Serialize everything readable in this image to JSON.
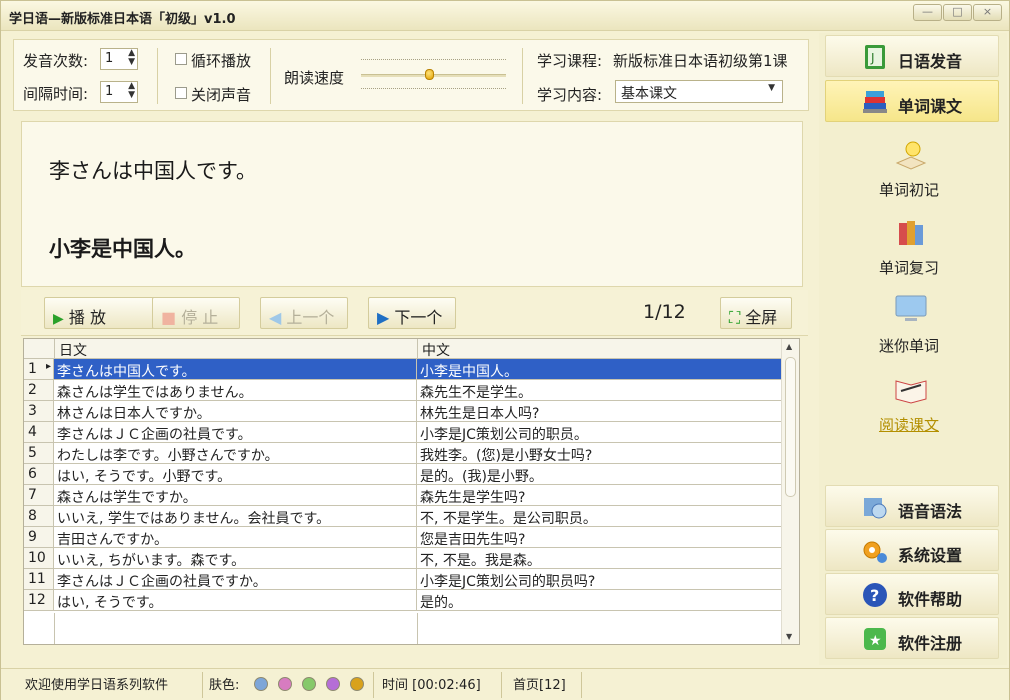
{
  "window": {
    "title": "学日语—新版标准日本语「初级」v1.0",
    "min": "—",
    "max": "□",
    "close": "×"
  },
  "toolbar": {
    "repeat_label": "发音次数:",
    "repeat_value": "1",
    "interval_label": "间隔时间:",
    "interval_value": "1",
    "loop_label": "循环播放",
    "mute_label": "关闭声音",
    "speed_label": "朗读速度",
    "course_label": "学习课程:",
    "course_value": "新版标准日本语初级第1课",
    "content_label": "学习内容:",
    "content_value": "基本课文",
    "speed_level": 0.47
  },
  "display": {
    "japanese": "李さんは中国人です。",
    "chinese": "小李是中国人。"
  },
  "controls": {
    "play": "播 放",
    "stop": "停 止",
    "prev": "上一个",
    "next": "下一个",
    "counter": "1/12",
    "fullscreen": "全屏"
  },
  "grid": {
    "col_japanese": "日文",
    "col_chinese": "中文",
    "rows": [
      {
        "n": "1",
        "ja": "李さんは中国人です。",
        "zh": "小李是中国人。"
      },
      {
        "n": "2",
        "ja": "森さんは学生ではありません。",
        "zh": "森先生不是学生。"
      },
      {
        "n": "3",
        "ja": "林さんは日本人ですか。",
        "zh": "林先生是日本人吗?"
      },
      {
        "n": "4",
        "ja": "李さんはＪＣ企画の社員です。",
        "zh": "小李是JC策划公司的职员。"
      },
      {
        "n": "5",
        "ja": "わたしは李です。小野さんですか。",
        "zh": "我姓李。(您)是小野女士吗?"
      },
      {
        "n": "6",
        "ja": "はい, そうです。小野です。",
        "zh": "是的。(我)是小野。"
      },
      {
        "n": "7",
        "ja": "森さんは学生ですか。",
        "zh": "森先生是学生吗?"
      },
      {
        "n": "8",
        "ja": "いいえ, 学生ではありません。会社員です。",
        "zh": "不, 不是学生。是公司职员。"
      },
      {
        "n": "9",
        "ja": "吉田さんですか。",
        "zh": "您是吉田先生吗?"
      },
      {
        "n": "10",
        "ja": "いいえ, ちがいます。森です。",
        "zh": "不, 不是。我是森。"
      },
      {
        "n": "11",
        "ja": "李さんはＪＣ企画の社員ですか。",
        "zh": "小李是JC策划公司的职员吗?"
      },
      {
        "n": "12",
        "ja": "はい, そうです。",
        "zh": "是的。"
      }
    ]
  },
  "nav": {
    "pronunciation": "日语发音",
    "vocab_text": "单词课文",
    "vocab_first": "单词初记",
    "vocab_review": "单词复习",
    "mini_words": "迷你单词",
    "read_text": "阅读课文",
    "grammar": "语音语法",
    "settings": "系统设置",
    "help": "软件帮助",
    "register": "软件注册"
  },
  "status": {
    "welcome": "欢迎使用学日语系列软件",
    "skin_label": "肤色:",
    "time": "时间 [00:02:46]",
    "home": "首页[12]",
    "skin_colors": [
      "#7ea6d8",
      "#d77cc0",
      "#86c96a",
      "#b56ed6",
      "#d9a21b"
    ]
  }
}
